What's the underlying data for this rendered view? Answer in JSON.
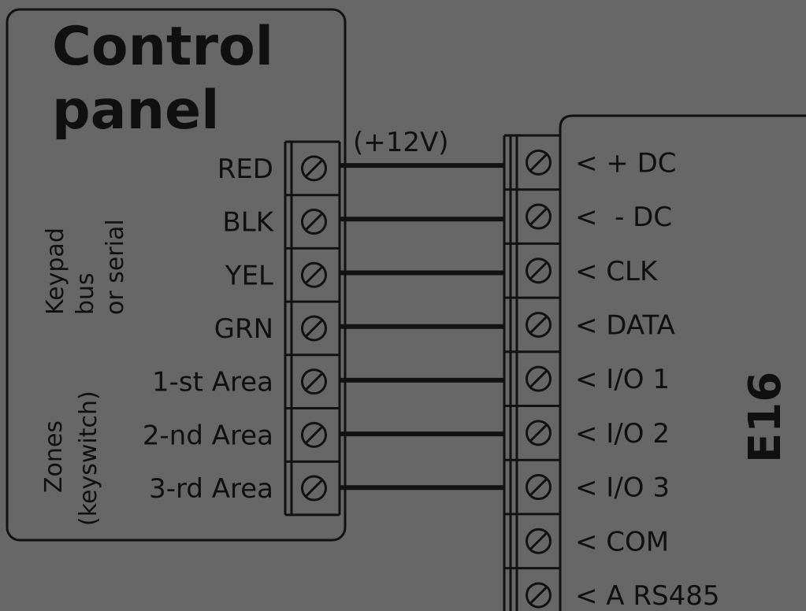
{
  "control_panel": {
    "title_line1": "Control",
    "title_line2": "panel",
    "groups": {
      "keypad": [
        "Keypad",
        "bus",
        "or serial"
      ],
      "zones": [
        "Zones",
        "(keyswitch)"
      ]
    },
    "terminals": [
      "RED",
      "BLK",
      "YEL",
      "GRN",
      "1-st Area",
      "2-nd Area",
      "3-rd Area"
    ]
  },
  "wire_note": "(+12V)",
  "e16": {
    "title": "E16",
    "terminals": [
      "< + DC",
      "<  - DC",
      "< CLK",
      "< DATA",
      "< I/O 1",
      "< I/O 2",
      "< I/O 3",
      "< COM",
      "< A RS485"
    ]
  },
  "connections": [
    [
      0,
      0
    ],
    [
      1,
      1
    ],
    [
      2,
      2
    ],
    [
      3,
      3
    ],
    [
      4,
      4
    ],
    [
      5,
      5
    ],
    [
      6,
      6
    ]
  ],
  "colors": {
    "background": "#676767",
    "ink": "#121212"
  }
}
